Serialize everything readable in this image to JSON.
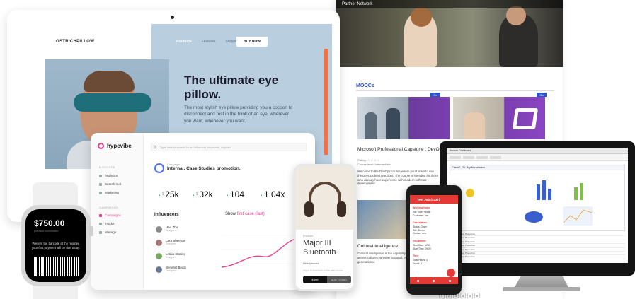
{
  "laptop_site": {
    "brand": "OSTRICHPILLOW",
    "nav": [
      "Products",
      "Features",
      "Shipping"
    ],
    "buy_label": "BUY NOW",
    "headline": "The ultimate eye pillow.",
    "description": "The most stylish eye pillow providing you a cocoon to disconnect and rest in the blink of an eye, wherever you want, whenever you want.",
    "cta_label": "BUY NOW"
  },
  "dashboard": {
    "logo": "hypevibe",
    "search_placeholder": "Type here to search for an influencer, keywords, tags etc.",
    "section_1": "MODULES",
    "nav_1": [
      "Analytics",
      "Search tool",
      "Marketing"
    ],
    "section_2": "CAMPAIGNS",
    "nav_2": [
      "Campaigns",
      "Tracks",
      "Manage"
    ],
    "promo_small": "Campaign",
    "promo": "Internal. Case Studies promotion.",
    "stats": [
      {
        "prefix": "$",
        "value": "25k"
      },
      {
        "prefix": "$",
        "value": "32k"
      },
      {
        "prefix": "",
        "value": "104"
      },
      {
        "prefix": "",
        "value": "1.04x"
      }
    ],
    "influencers_label": "Influencers",
    "show_label": "Show",
    "show_value": "first case (last)",
    "influencers": [
      {
        "name": "Hao Zhu",
        "sub": "Designer"
      },
      {
        "name": "Lara Sheehan",
        "sub": "Designer"
      },
      {
        "name": "Letitia Stanley",
        "sub": "Designer"
      },
      {
        "name": "Benefist Beats",
        "sub": "Designer"
      }
    ]
  },
  "watch": {
    "amount": "$750.00",
    "sub": "purchase confirmation",
    "message": "Present the barcode at the register, your first payment will be due today."
  },
  "headphones_app": {
    "tag": "Product",
    "title_line1": "Major III",
    "title_line2": "Bluetooth",
    "pill": "Headphones",
    "desc": "Major III Bluetooth is the best choice",
    "btn_dark": "$ 699",
    "btn_light": "ADD TO BAG"
  },
  "mooc_site": {
    "header": "Partner Network",
    "section": "MOOCs",
    "badge": "Go",
    "course_title": "Microsoft Professional Capstone : DevOps",
    "course_meta_1": "Rating: ☆ ☆ ☆ ☆",
    "course_meta_2": "Course level: Intermediate",
    "course_body": "Welcome to the DevOps course where you'll learn to use the DevOps best practices. The course is intended for those who already have experience with modern software development.",
    "course2_title": "Cultural Intelligence",
    "course2_body": "Cultural intelligence is the capability to function effectively across cultures, whether national, ethnic, organizational or generational.",
    "pager": [
      "1",
      "2",
      "3",
      "4",
      "5",
      "6"
    ]
  },
  "job_app": {
    "title": "Test Job (#237)",
    "label_1": "Working Notes",
    "label_2": "Description",
    "label_3": "Equipment",
    "label_4": "Time",
    "lines_1": [
      "Job Type: Repair",
      "Customer: Joe"
    ],
    "lines_2": [
      "Status: Open",
      "Site: Demo",
      "Contact: Ann"
    ],
    "lines_3": [
      "Start Date: 12/01",
      "Start Time: 09:00"
    ],
    "lines_4": [
      "Total Hours: 4",
      "Travel: 1"
    ]
  },
  "ds_app": {
    "window_title": "Remote Dashboard",
    "panel_1": "Client Status",
    "panel_2": "Client 1, 2K, MyWorkstation",
    "panel_3": "Hosts",
    "panel_4": "Active Jobs",
    "table_rows": [
      "Job_1 Backup Production",
      "Job_2 Backup Production",
      "Job_3 Backup Production",
      "Job_4 Backup Production",
      "Job_5 Backup Production",
      "Job_6 Backup Production",
      "Job_7 Backup Production",
      "Job_8 Backup Production"
    ]
  },
  "colors": {
    "accent_orange": "#f0764a",
    "accent_pink": "#e83f8c",
    "accent_blue": "#2a55c8",
    "accent_red": "#e53935"
  }
}
